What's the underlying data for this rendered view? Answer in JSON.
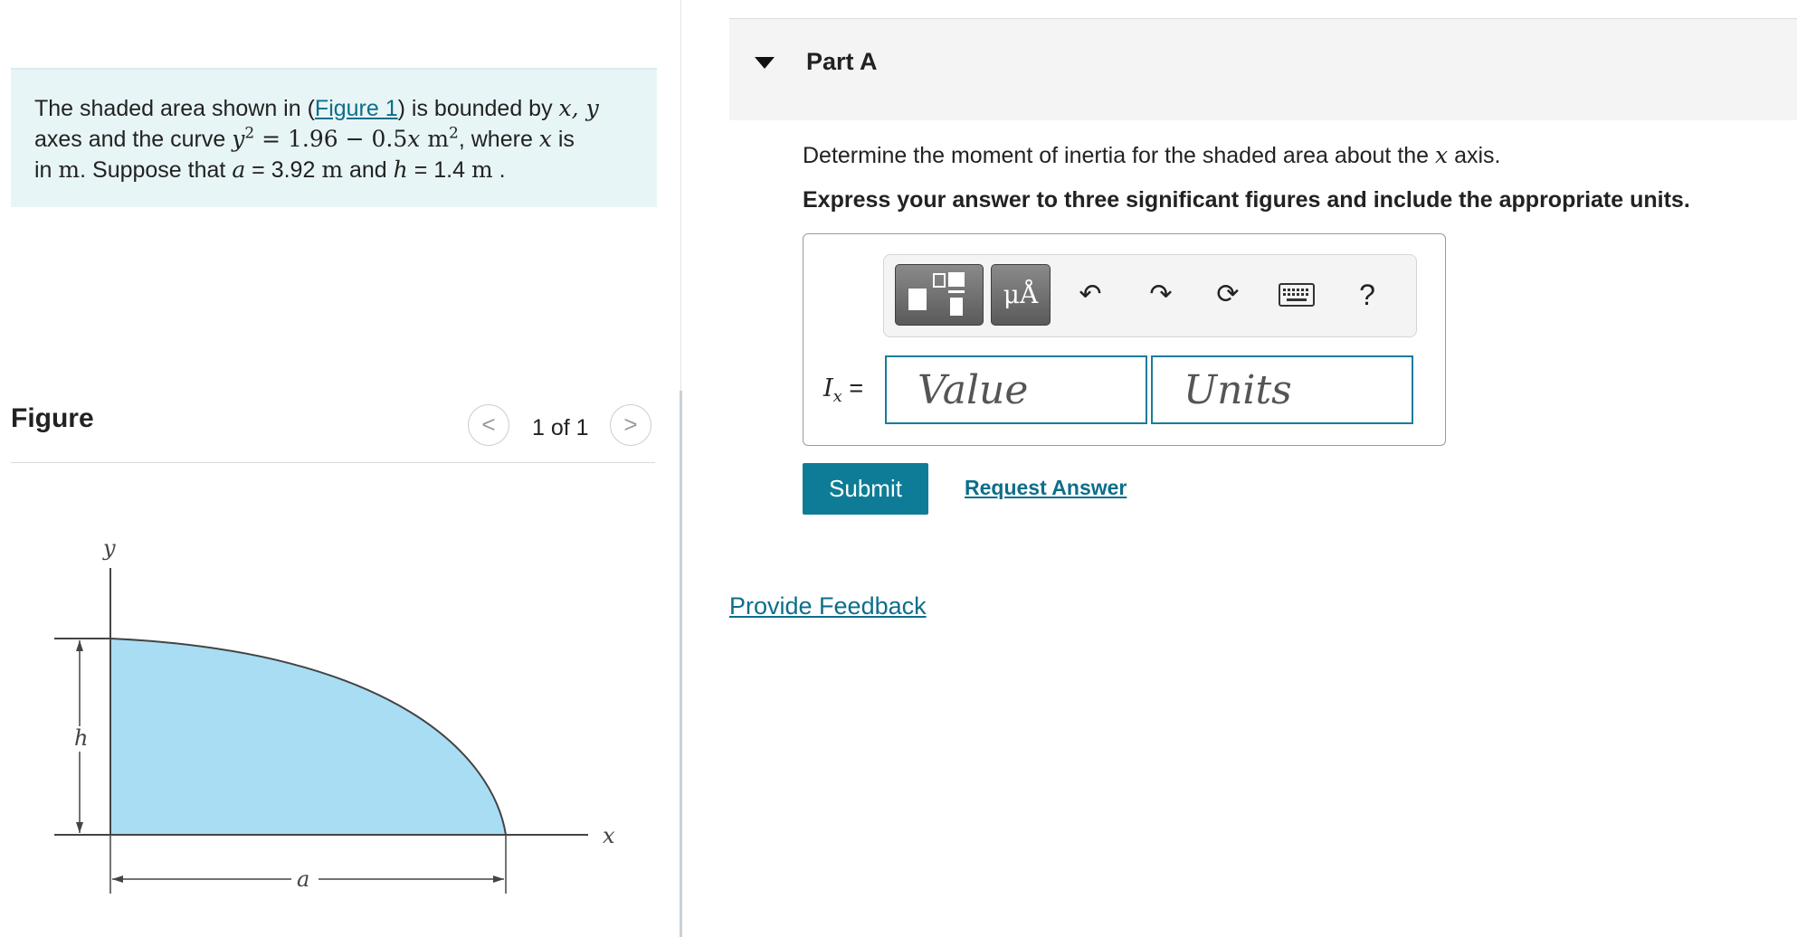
{
  "problem": {
    "text_1": "The shaded area shown in (",
    "figure_link": "Figure 1",
    "text_2": ") is bounded by ",
    "var_x": "x",
    "comma": ", ",
    "var_y": "y",
    "text_3": "axes and the curve ",
    "curve_lhs": "y",
    "curve_lhs_exp": "2",
    "curve_eq": " = 1.96 − 0.5",
    "curve_x": "x",
    "curve_unit": " m",
    "curve_unit_exp": "2",
    "text_4": ", where ",
    "where_x": "x",
    "text_5": " is",
    "text_6": "in ",
    "in_unit": "m",
    "text_7": ". Suppose that ",
    "a_var": "a",
    "a_val": " = 3.92 ",
    "a_unit": " m",
    "text_8": " and ",
    "h_var": "h",
    "h_val": " = 1.4 ",
    "h_unit": " m",
    "text_9": " ."
  },
  "figure_panel": {
    "title": "Figure",
    "prev_icon": "<",
    "next_icon": ">",
    "counter": "1 of 1",
    "labels": {
      "y": "y",
      "x": "x",
      "h": "h",
      "a": "a"
    }
  },
  "part": {
    "title": "Part A",
    "question_pre": "Determine the moment of inertia for the shaded area about the ",
    "question_var": "x",
    "question_post": " axis.",
    "instruction": "Express your answer to three significant figures and include the appropriate units."
  },
  "answer": {
    "label_var": "I",
    "label_sub": "x",
    "label_eq": " =",
    "value_placeholder": "Value",
    "units_placeholder": "Units",
    "units_btn": "μÅ",
    "help": "?",
    "undo_icon": "↶",
    "redo_icon": "↷",
    "reset_icon": "⟳"
  },
  "actions": {
    "submit": "Submit",
    "request": "Request Answer",
    "feedback": "Provide Feedback"
  },
  "colors": {
    "shaded_area": "#a9ddf4",
    "link": "#0d6e8a",
    "submit_bg": "#0e7c96",
    "problem_bg": "#e8f5f6"
  }
}
